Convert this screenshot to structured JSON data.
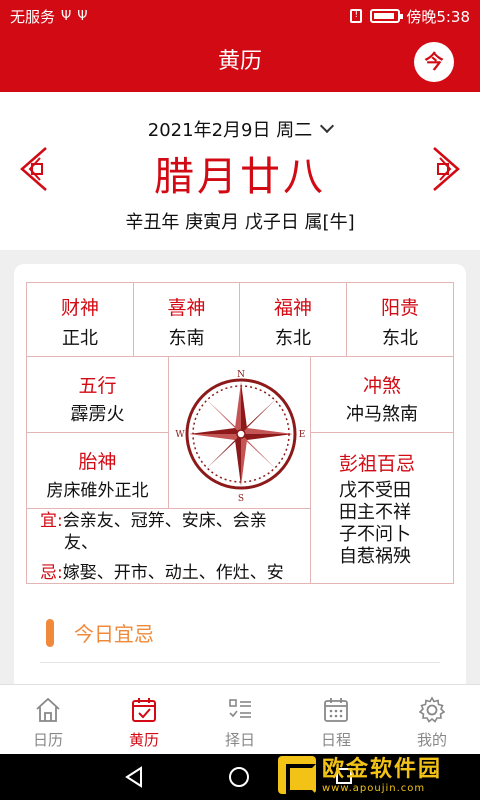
{
  "status_bar": {
    "carrier": "无服务",
    "usb_icons": [
      "usb-icon",
      "usb-icon"
    ],
    "time": "傍晚5:38",
    "battery_level": 0.9
  },
  "app_bar": {
    "title": "黄历",
    "today_button": "今"
  },
  "header": {
    "solar_date": "2021年2月9日 周二",
    "lunar_date": "腊月廿八",
    "ganzhi": "辛丑年 庚寅月 戊子日 属[牛]"
  },
  "gods": [
    {
      "label": "财神",
      "value": "正北"
    },
    {
      "label": "喜神",
      "value": "东南"
    },
    {
      "label": "福神",
      "value": "东北"
    },
    {
      "label": "阳贵",
      "value": "东北"
    }
  ],
  "wuxing": {
    "label": "五行",
    "value": "霹雳火"
  },
  "chongsha": {
    "label": "冲煞",
    "value": "冲马煞南"
  },
  "taishen": {
    "label": "胎神",
    "value": "房床碓外正北"
  },
  "pengzu": {
    "label": "彭祖百忌",
    "lines": [
      "戊不受田",
      "田主不祥",
      "子不问卜",
      "自惹祸殃"
    ]
  },
  "compass": {
    "n": "N",
    "e": "E",
    "s": "S",
    "w": "W"
  },
  "yi": {
    "tag": "宜:",
    "line1": "会亲友、冠笄、安床、会亲",
    "line2": "友、"
  },
  "ji": {
    "tag": "忌:",
    "line1": "嫁娶、开市、动土、作灶、安"
  },
  "section": {
    "title": "今日宜忌"
  },
  "tabs": [
    {
      "label": "日历",
      "icon": "home-icon"
    },
    {
      "label": "黄历",
      "icon": "calendar-check-icon",
      "active": true
    },
    {
      "label": "择日",
      "icon": "checklist-icon"
    },
    {
      "label": "日程",
      "icon": "schedule-icon"
    },
    {
      "label": "我的",
      "icon": "gear-icon"
    }
  ],
  "watermark": {
    "title": "欧金软件园",
    "url": "www.apoujin.com"
  },
  "colors": {
    "brand_red": "#d20a14",
    "accent_orange": "#f08a3a"
  }
}
